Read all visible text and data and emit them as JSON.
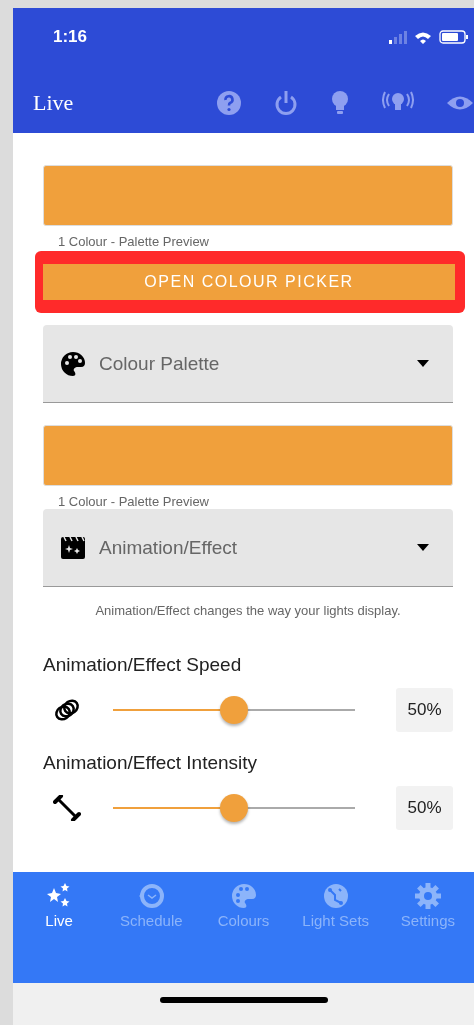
{
  "status_bar": {
    "time": "1:16"
  },
  "header": {
    "title": "Live"
  },
  "content": [
    {
      "kind": "swatch",
      "color": "#f0a03c",
      "caption": "1 Colour - Palette Preview"
    },
    {
      "kind": "button",
      "label": "OPEN COLOUR PICKER",
      "highlighted": true
    },
    {
      "kind": "dropdown",
      "label": "Colour Palette"
    },
    {
      "kind": "swatch",
      "color": "#f0a03c",
      "caption": "1 Colour - Palette Preview"
    },
    {
      "kind": "dropdown",
      "label": "Animation/Effect",
      "helper": "Animation/Effect changes the way your lights display."
    },
    {
      "kind": "slider",
      "label": "Animation/Effect Speed",
      "level": 0.5,
      "reading": "50%"
    },
    {
      "kind": "slider",
      "label": "Animation/Effect Intensity",
      "level": 0.5,
      "reading": "50%"
    }
  ],
  "tabs": [
    {
      "label": "Live",
      "selected": true
    },
    {
      "label": "Schedule",
      "selected": false
    },
    {
      "label": "Colours",
      "selected": false
    },
    {
      "label": "Light Sets",
      "selected": false
    },
    {
      "label": "Settings",
      "selected": false
    }
  ]
}
